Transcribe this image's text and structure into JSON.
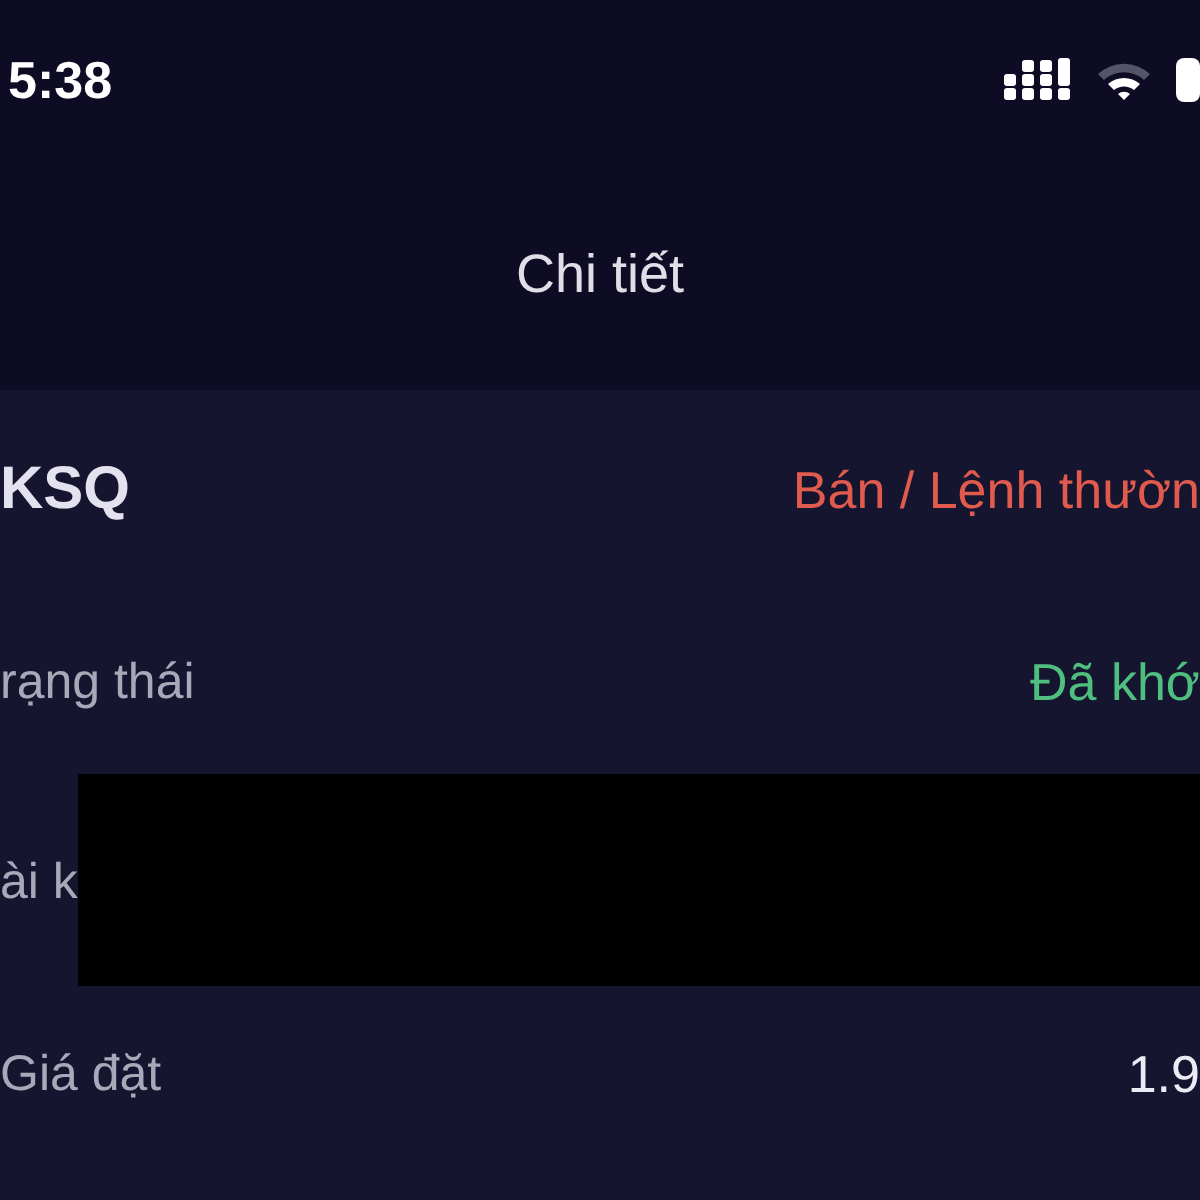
{
  "status_bar": {
    "time": "5:38"
  },
  "header": {
    "title": "Chi tiết"
  },
  "order": {
    "symbol": "KSQ",
    "side": "Bán / Lệnh thườn",
    "kind": "sell"
  },
  "fields": [
    {
      "label": "rạng thái",
      "value": "Đã khớ",
      "kind": "status"
    },
    {
      "label": "ài k",
      "kind": "redacted"
    },
    {
      "label": "Giá đặt",
      "value": "1.9",
      "kind": "plain"
    }
  ]
}
